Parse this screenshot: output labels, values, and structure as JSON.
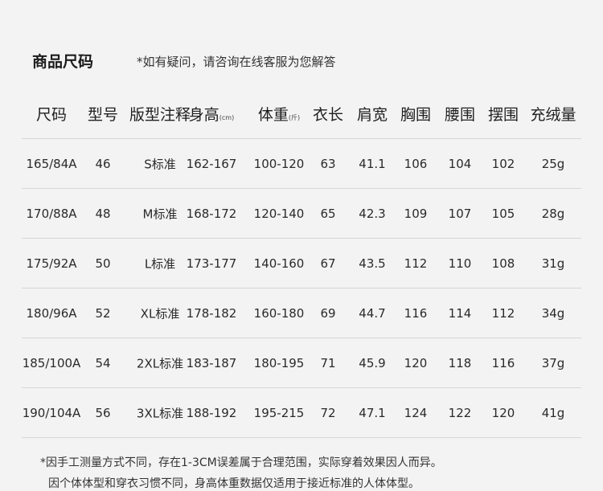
{
  "title": "商品尺码",
  "note": "*如有疑问，请咨询在线客服为您解答",
  "headers": [
    {
      "label": "尺码",
      "unit": ""
    },
    {
      "label": "型号",
      "unit": ""
    },
    {
      "label": "版型注释",
      "unit": ""
    },
    {
      "label": "身高",
      "unit": "(cm)"
    },
    {
      "label": "体重",
      "unit": "(斤)"
    },
    {
      "label": "衣长",
      "unit": ""
    },
    {
      "label": "肩宽",
      "unit": ""
    },
    {
      "label": "胸围",
      "unit": ""
    },
    {
      "label": "腰围",
      "unit": ""
    },
    {
      "label": "摆围",
      "unit": ""
    },
    {
      "label": "充绒量",
      "unit": ""
    }
  ],
  "rows": [
    [
      "165/84A",
      "46",
      "S标准",
      "162-167",
      "100-120",
      "63",
      "41.1",
      "106",
      "104",
      "102",
      "25g"
    ],
    [
      "170/88A",
      "48",
      "M标准",
      "168-172",
      "120-140",
      "65",
      "42.3",
      "109",
      "107",
      "105",
      "28g"
    ],
    [
      "175/92A",
      "50",
      "L标准",
      "173-177",
      "140-160",
      "67",
      "43.5",
      "112",
      "110",
      "108",
      "31g"
    ],
    [
      "180/96A",
      "52",
      "XL标准",
      "178-182",
      "160-180",
      "69",
      "44.7",
      "116",
      "114",
      "112",
      "34g"
    ],
    [
      "185/100A",
      "54",
      "2XL标准",
      "183-187",
      "180-195",
      "71",
      "45.9",
      "120",
      "118",
      "116",
      "37g"
    ],
    [
      "190/104A",
      "56",
      "3XL标准",
      "188-192",
      "195-215",
      "72",
      "47.1",
      "124",
      "122",
      "120",
      "41g"
    ]
  ],
  "footnotes": [
    "*因手工测量方式不同，存在1-3CM误差属于合理范围，实际穿着效果因人而异。",
    "因个体体型和穿衣习惯不同，身高体重数据仅适用于接近标准的人体体型。"
  ]
}
